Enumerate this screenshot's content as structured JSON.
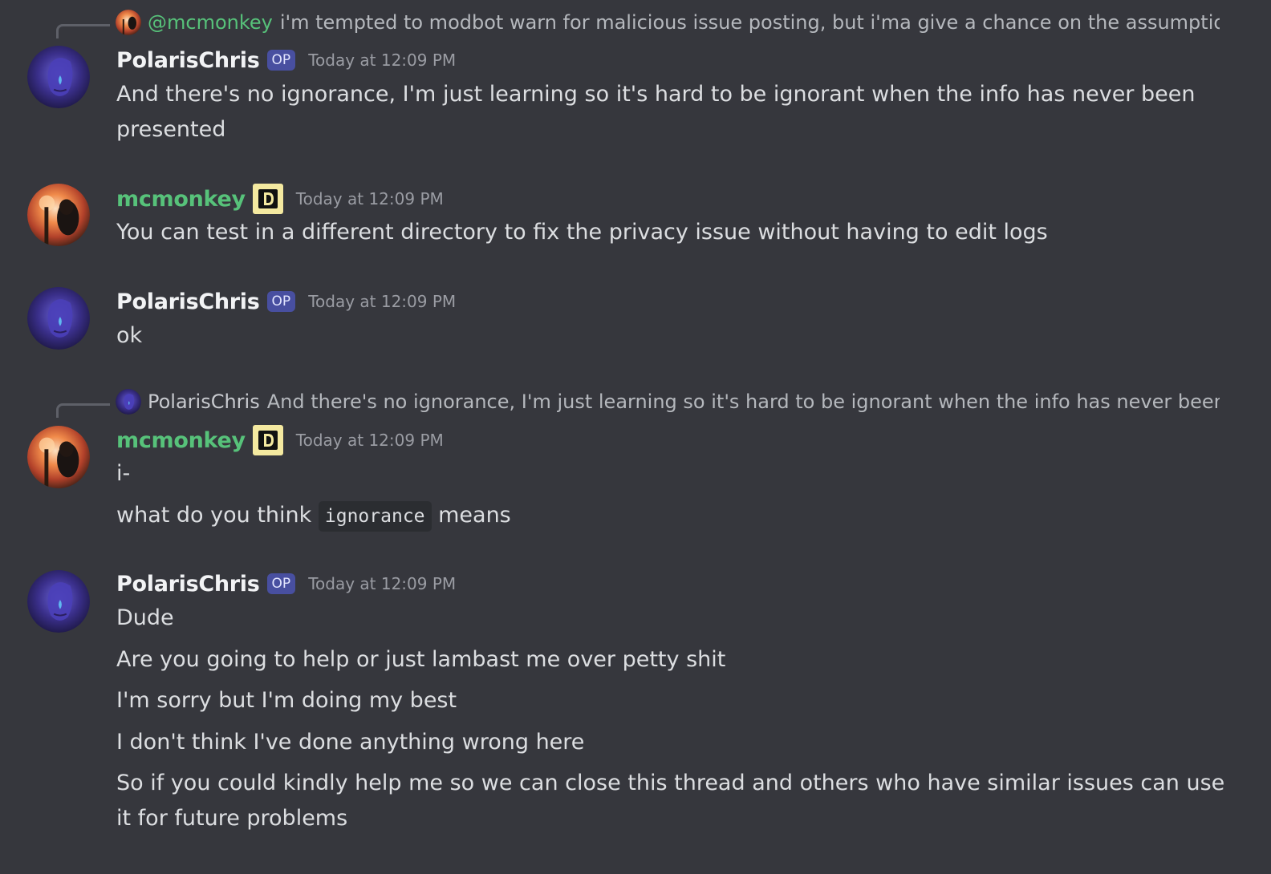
{
  "colors": {
    "background": "#36373d",
    "polaris_name": "#f2f3f5",
    "mcmonkey_name": "#57c27a",
    "timestamp": "#9a9ca3",
    "text": "#dcdee1",
    "op_badge": "#5865f2",
    "d_badge": "#f4e9a0"
  },
  "messages": [
    {
      "reply": {
        "avatar_icon": "mcmonkey-avatar-icon",
        "name": "@mcmonkey",
        "text": "i'm tempted to modbot warn for malicious issue posting, but i'ma give a chance on the assumption tl"
      },
      "author": "PolarisChris",
      "badge": "OP",
      "timestamp": "Today at 12:09 PM",
      "lines": [
        "And there's no ignorance, I'm just learning so it's hard to be ignorant when the info has never been",
        "presented"
      ]
    },
    {
      "author": "mcmonkey",
      "badge_icon": "d-badge-icon",
      "timestamp": "Today at 12:09 PM",
      "lines": [
        "You can test in a different directory to fix the privacy issue without having to edit logs"
      ]
    },
    {
      "author": "PolarisChris",
      "badge": "OP",
      "timestamp": "Today at 12:09 PM",
      "lines": [
        "ok"
      ]
    },
    {
      "reply": {
        "avatar_icon": "polarischris-avatar-icon",
        "name": "PolarisChris",
        "text": "And there's no ignorance, I'm just learning so it's hard to be ignorant when the info has never been pre"
      },
      "author": "mcmonkey",
      "badge_icon": "d-badge-icon",
      "timestamp": "Today at 12:09 PM",
      "lines": [
        "i-"
      ],
      "code_line": {
        "before": "what do you think",
        "code": "ignorance",
        "after": "means"
      }
    },
    {
      "author": "PolarisChris",
      "badge": "OP",
      "timestamp": "Today at 12:09 PM",
      "lines": [
        "Dude",
        "Are you going to help or just lambast me over petty shit",
        "I'm sorry but I'm doing my best",
        "I don't think I've done anything wrong here",
        "So if you could kindly help me so we can close this thread and others who have similar issues can use",
        "it for future problems"
      ]
    }
  ]
}
